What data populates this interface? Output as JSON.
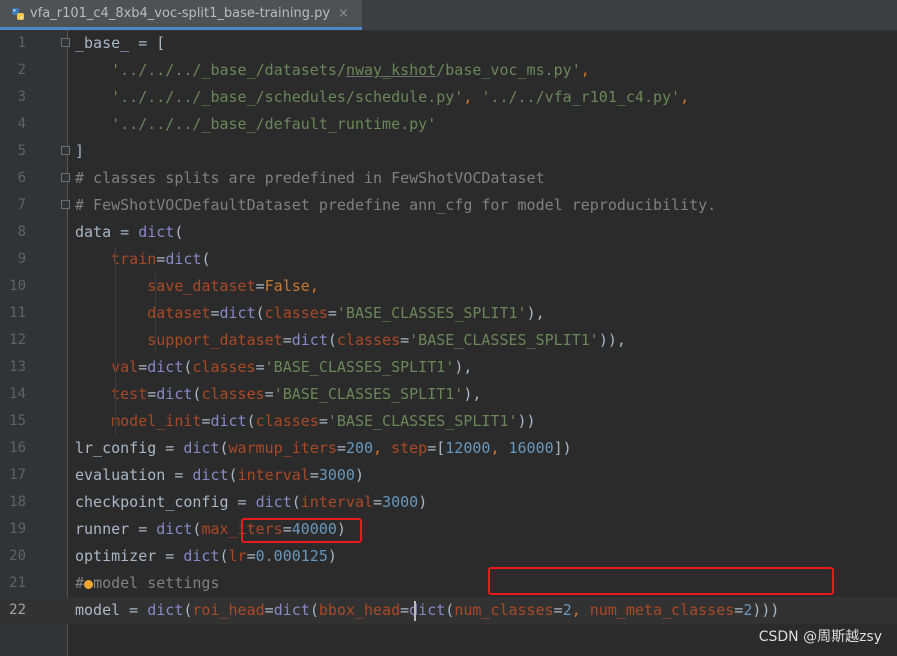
{
  "tab": {
    "filename": "vfa_r101_c4_8xb4_voc-split1_base-training.py",
    "close": "×"
  },
  "editor": {
    "current_line": 22,
    "lines": [
      [
        [
          "_base_ = [",
          "t"
        ]
      ],
      [
        [
          "    ",
          "t"
        ],
        [
          "'../../../_base_/datasets/nway_kshot/base_voc_ms.py'",
          "s"
        ],
        [
          ",",
          "k"
        ]
      ],
      [
        [
          "    ",
          "t"
        ],
        [
          "'../../../_base_/schedules/schedule.py'",
          "s"
        ],
        [
          ", ",
          "k"
        ],
        [
          "'../../vfa_r101_c4.py'",
          "s"
        ],
        [
          ",",
          "k"
        ]
      ],
      [
        [
          "    ",
          "t"
        ],
        [
          "'../../../_base_/default_runtime.py'",
          "s"
        ]
      ],
      [
        [
          "]",
          "t"
        ]
      ],
      [
        [
          "# classes splits are predefined in FewShotVOCDataset",
          "c"
        ]
      ],
      [
        [
          "# FewShotVOCDefaultDataset predefine ann_cfg for model reproducibility.",
          "c"
        ]
      ],
      [
        [
          "data = ",
          "t"
        ],
        [
          "dict",
          "b"
        ],
        [
          "(",
          "t"
        ]
      ],
      [
        [
          "    ",
          "t"
        ],
        [
          "train",
          "p"
        ],
        [
          "=",
          "t"
        ],
        [
          "dict",
          "b"
        ],
        [
          "(",
          "t"
        ]
      ],
      [
        [
          "        ",
          "t"
        ],
        [
          "save_dataset",
          "p"
        ],
        [
          "=",
          "t"
        ],
        [
          "False",
          "k"
        ],
        [
          ",",
          "k"
        ]
      ],
      [
        [
          "        ",
          "t"
        ],
        [
          "dataset",
          "p"
        ],
        [
          "=",
          "t"
        ],
        [
          "dict",
          "b"
        ],
        [
          "(",
          "t"
        ],
        [
          "classes",
          "p"
        ],
        [
          "=",
          "t"
        ],
        [
          "'BASE_CLASSES_SPLIT1'",
          "s"
        ],
        [
          "),",
          "t"
        ]
      ],
      [
        [
          "        ",
          "t"
        ],
        [
          "support_dataset",
          "p"
        ],
        [
          "=",
          "t"
        ],
        [
          "dict",
          "b"
        ],
        [
          "(",
          "t"
        ],
        [
          "classes",
          "p"
        ],
        [
          "=",
          "t"
        ],
        [
          "'BASE_CLASSES_SPLIT1'",
          "s"
        ],
        [
          ")),",
          "t"
        ]
      ],
      [
        [
          "    ",
          "t"
        ],
        [
          "val",
          "p"
        ],
        [
          "=",
          "t"
        ],
        [
          "dict",
          "b"
        ],
        [
          "(",
          "t"
        ],
        [
          "classes",
          "p"
        ],
        [
          "=",
          "t"
        ],
        [
          "'BASE_CLASSES_SPLIT1'",
          "s"
        ],
        [
          "),",
          "t"
        ]
      ],
      [
        [
          "    ",
          "t"
        ],
        [
          "test",
          "p"
        ],
        [
          "=",
          "t"
        ],
        [
          "dict",
          "b"
        ],
        [
          "(",
          "t"
        ],
        [
          "classes",
          "p"
        ],
        [
          "=",
          "t"
        ],
        [
          "'BASE_CLASSES_SPLIT1'",
          "s"
        ],
        [
          "),",
          "t"
        ]
      ],
      [
        [
          "    ",
          "t"
        ],
        [
          "model_init",
          "p"
        ],
        [
          "=",
          "t"
        ],
        [
          "dict",
          "b"
        ],
        [
          "(",
          "t"
        ],
        [
          "classes",
          "p"
        ],
        [
          "=",
          "t"
        ],
        [
          "'BASE_CLASSES_SPLIT1'",
          "s"
        ],
        [
          "))",
          "t"
        ]
      ],
      [
        [
          "lr_config = ",
          "t"
        ],
        [
          "dict",
          "b"
        ],
        [
          "(",
          "t"
        ],
        [
          "warmup_iters",
          "p"
        ],
        [
          "=",
          "t"
        ],
        [
          "200",
          "n"
        ],
        [
          ", ",
          "k"
        ],
        [
          "step",
          "p"
        ],
        [
          "=[",
          "t"
        ],
        [
          "12000",
          "n"
        ],
        [
          ", ",
          "k"
        ],
        [
          "16000",
          "n"
        ],
        [
          "])",
          "t"
        ]
      ],
      [
        [
          "evaluation = ",
          "t"
        ],
        [
          "dict",
          "b"
        ],
        [
          "(",
          "t"
        ],
        [
          "interval",
          "p"
        ],
        [
          "=",
          "t"
        ],
        [
          "3000",
          "n"
        ],
        [
          ")",
          "t"
        ]
      ],
      [
        [
          "checkpoint_config = ",
          "t"
        ],
        [
          "dict",
          "b"
        ],
        [
          "(",
          "t"
        ],
        [
          "interval",
          "p"
        ],
        [
          "=",
          "t"
        ],
        [
          "3000",
          "n"
        ],
        [
          ")",
          "t"
        ]
      ],
      [
        [
          "runner = ",
          "t"
        ],
        [
          "dict",
          "b"
        ],
        [
          "(",
          "t"
        ],
        [
          "max_iters",
          "p"
        ],
        [
          "=",
          "t"
        ],
        [
          "40000",
          "n"
        ],
        [
          ")",
          "t"
        ]
      ],
      [
        [
          "optimizer = ",
          "t"
        ],
        [
          "dict",
          "b"
        ],
        [
          "(",
          "t"
        ],
        [
          "lr",
          "p"
        ],
        [
          "=",
          "t"
        ],
        [
          "0.000125",
          "n"
        ],
        [
          ")",
          "t"
        ]
      ],
      [
        [
          "# ",
          "c"
        ],
        [
          "model settings",
          "c"
        ]
      ],
      [
        [
          "model = ",
          "t"
        ],
        [
          "dict",
          "b"
        ],
        [
          "(",
          "t"
        ],
        [
          "roi_head",
          "p"
        ],
        [
          "=",
          "t"
        ],
        [
          "dict",
          "b"
        ],
        [
          "(",
          "t"
        ],
        [
          "bbox_head",
          "p"
        ],
        [
          "=",
          "t"
        ],
        [
          "dict",
          "b"
        ],
        [
          "(",
          "t"
        ],
        [
          "num_classes",
          "p"
        ],
        [
          "=",
          "t"
        ],
        [
          "2",
          "n"
        ],
        [
          ", ",
          "k"
        ],
        [
          "num_meta_classes",
          "p"
        ],
        [
          "=",
          "t"
        ],
        [
          "2",
          "n"
        ],
        [
          ")))",
          "t"
        ]
      ]
    ]
  },
  "watermark": "CSDN @周斯越zsy"
}
